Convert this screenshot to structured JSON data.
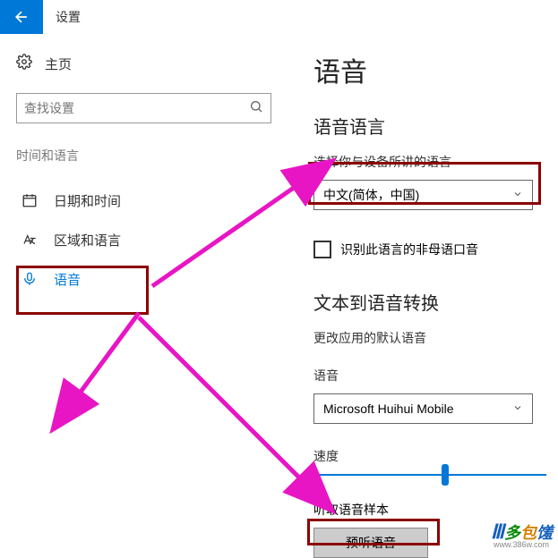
{
  "header": {
    "title": "设置"
  },
  "sidebar": {
    "home": "主页",
    "search_placeholder": "查找设置",
    "category": "时间和语言",
    "items": [
      {
        "label": "日期和时间"
      },
      {
        "label": "区域和语言"
      },
      {
        "label": "语音"
      }
    ]
  },
  "main": {
    "title": "语音",
    "lang_section": "语音语言",
    "lang_subtext": "选择你与设备所讲的语言",
    "lang_selected": "中文(简体，中国)",
    "checkbox_label": "识别此语言的非母语口音",
    "tts_section": "文本到语音转换",
    "tts_subtext": "更改应用的默认语音",
    "voice_label": "语音",
    "voice_selected": "Microsoft Huihui Mobile",
    "speed_label": "速度",
    "sample_label": "听取语音样本",
    "preview_button": "预听语音"
  },
  "watermark": {
    "brand": "多包馐",
    "url": "www.386w.com"
  }
}
